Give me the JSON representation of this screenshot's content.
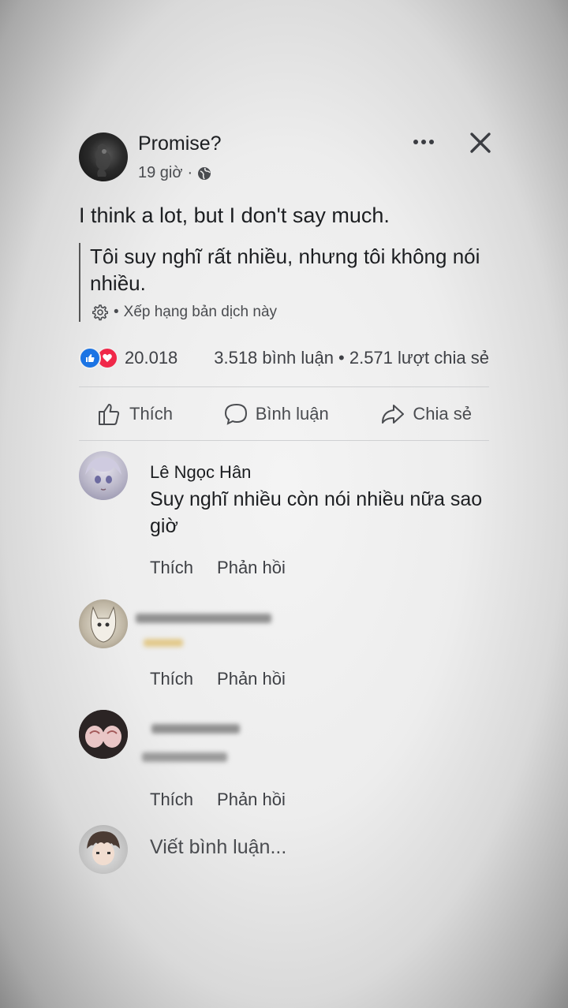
{
  "post": {
    "author": "Promise?",
    "time": "19 giờ",
    "separator": "·",
    "text": "I think a lot, but I don't say much.",
    "translation": "Tôi suy nghĩ rất nhiều, nhưng tôi không nói nhiều.",
    "rate_translation": "Xếp hạng bản dịch này"
  },
  "stats": {
    "reactions": "20.018",
    "comments_shares": "3.518 bình luận • 2.571 lượt chia sẻ"
  },
  "actions": {
    "like": "Thích",
    "comment": "Bình luận",
    "share": "Chia sẻ"
  },
  "comments": [
    {
      "name": "Lê Ngọc Hân",
      "text": "Suy nghĩ nhiều còn nói nhiều nữa sao giờ",
      "like": "Thích",
      "reply": "Phản hồi"
    },
    {
      "like": "Thích",
      "reply": "Phản hồi"
    },
    {
      "like": "Thích",
      "reply": "Phản hồi"
    }
  ],
  "composer": {
    "placeholder": "Viết bình luận..."
  },
  "colors": {
    "like_blue": "#1b74e4",
    "love_red": "#f02849",
    "text": "#1c1e21",
    "secondary": "#4a4c50"
  }
}
